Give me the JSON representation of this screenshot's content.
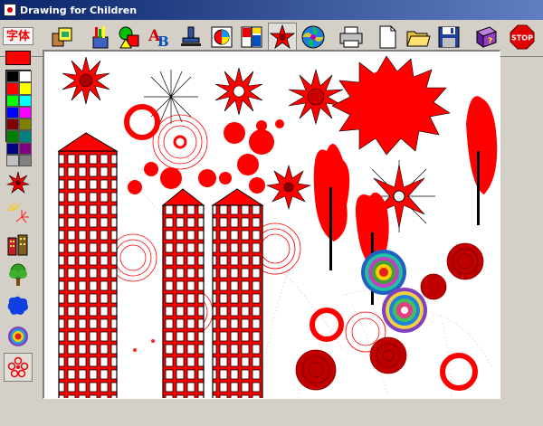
{
  "window": {
    "title": "Drawing for Children"
  },
  "toolbar": {
    "font_button_label": "字体",
    "tools": [
      {
        "name": "clipart-paste-icon"
      },
      {
        "name": "crayons-brush-icon"
      },
      {
        "name": "shapes-icon"
      },
      {
        "name": "text-ab-icon"
      },
      {
        "name": "stamp-icon"
      },
      {
        "name": "color-fill-icon"
      },
      {
        "name": "rectangles-icon"
      },
      {
        "name": "star-pattern-icon"
      },
      {
        "name": "spiral-pattern-icon"
      },
      {
        "name": "printer-icon"
      },
      {
        "name": "new-document-icon"
      },
      {
        "name": "open-folder-icon"
      },
      {
        "name": "save-disk-icon"
      },
      {
        "name": "help-book-icon"
      },
      {
        "name": "stop-exit-icon"
      }
    ]
  },
  "palette": {
    "current_color": "#ff0000",
    "colors": [
      "#000000",
      "#ffffff",
      "#ff0000",
      "#ffff00",
      "#00ff00",
      "#00ffff",
      "#0000ff",
      "#ff00ff",
      "#800000",
      "#808000",
      "#008000",
      "#008080",
      "#000080",
      "#800080",
      "#c0c0c0",
      "#808080"
    ]
  },
  "left_tools": [
    {
      "name": "star-brush-icon"
    },
    {
      "name": "fireworks-icon"
    },
    {
      "name": "building-icon"
    },
    {
      "name": "tree-icon"
    },
    {
      "name": "blob-icon"
    },
    {
      "name": "rings-icon"
    },
    {
      "name": "flower-icon"
    }
  ],
  "colors": {
    "drawing_red": "#ff0000",
    "title_blue": "#0a246a"
  }
}
